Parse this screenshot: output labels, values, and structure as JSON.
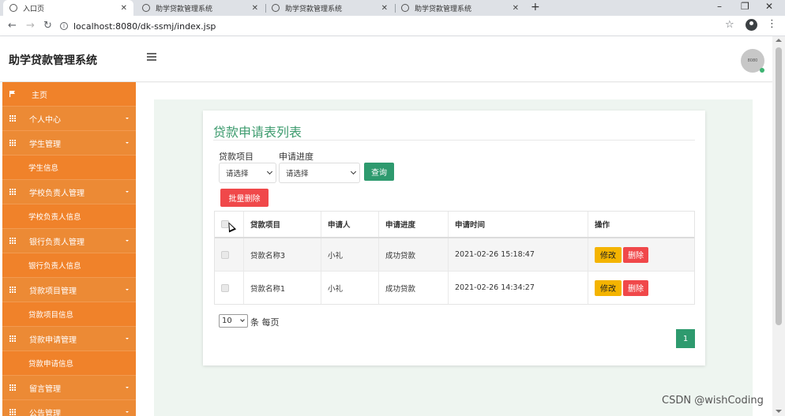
{
  "browser": {
    "tabs": [
      {
        "title": "入口页",
        "active": true
      },
      {
        "title": "助学贷款管理系统",
        "active": false
      },
      {
        "title": "助学贷款管理系统",
        "active": false
      },
      {
        "title": "助学贷款管理系统",
        "active": false
      }
    ],
    "url": "localhost:8080/dk-ssmj/index.jsp",
    "new_tab": "+",
    "controls": {
      "minimize": "–",
      "restore": "❐",
      "close": "✕"
    }
  },
  "header": {
    "brand": "助学贷款管理系统",
    "avatar_text": "8080"
  },
  "sidebar": {
    "items": [
      {
        "label": "主页",
        "type": "home"
      },
      {
        "label": "个人中心",
        "type": "group"
      },
      {
        "label": "学生管理",
        "type": "group"
      },
      {
        "label": "学生信息",
        "type": "sub"
      },
      {
        "label": "学校负责人管理",
        "type": "group"
      },
      {
        "label": "学校负责人信息",
        "type": "sub"
      },
      {
        "label": "银行负责人管理",
        "type": "group"
      },
      {
        "label": "银行负责人信息",
        "type": "sub"
      },
      {
        "label": "贷款项目管理",
        "type": "group"
      },
      {
        "label": "贷款项目信息",
        "type": "sub"
      },
      {
        "label": "贷款申请管理",
        "type": "group"
      },
      {
        "label": "贷款申请信息",
        "type": "sub"
      },
      {
        "label": "留言管理",
        "type": "group"
      },
      {
        "label": "公告管理",
        "type": "group"
      }
    ]
  },
  "main": {
    "title": "贷款申请表列表",
    "filters": {
      "project_label": "贷款项目",
      "project_value": "请选择",
      "progress_label": "申请进度",
      "progress_value": "请选择",
      "query_button": "查询"
    },
    "batch_delete_button": "批量删除",
    "table": {
      "headers": [
        "",
        "贷款项目",
        "申请人",
        "申请进度",
        "申请时间",
        "操作"
      ],
      "rows": [
        {
          "project": "贷款名称3",
          "applicant": "小礼",
          "progress": "成功贷款",
          "time": "2021-02-26 15:18:47"
        },
        {
          "project": "贷款名称1",
          "applicant": "小礼",
          "progress": "成功贷款",
          "time": "2021-02-26 14:34:27"
        }
      ],
      "edit_label": "修改",
      "delete_label": "删除"
    },
    "pagination": {
      "page_size": "10",
      "page_size_suffix": "条 每页",
      "current_page": "1"
    }
  },
  "watermark": "CSDN @wishCoding"
}
